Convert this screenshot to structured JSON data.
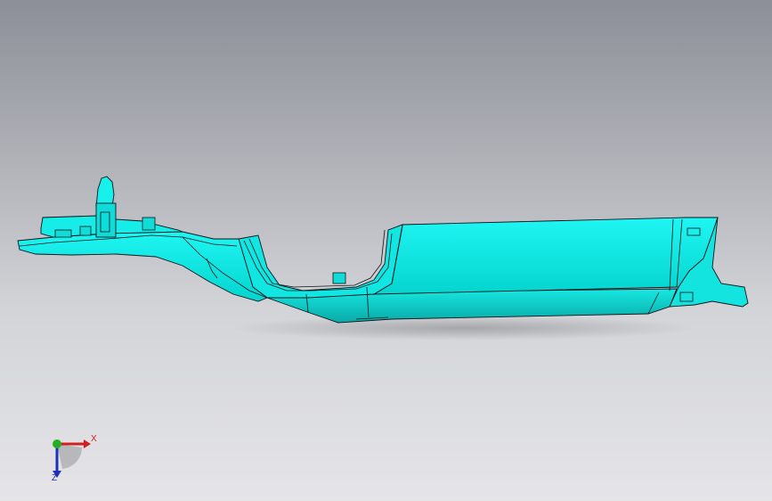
{
  "viewport": {
    "background_top": "#8c8f97",
    "background_bottom": "#e5e5e8",
    "part_color": "#00ffff",
    "edge_color": "#101418"
  },
  "triad": {
    "x_label": "X",
    "z_label": "Z",
    "x_color": "#d21f1f",
    "y_color": "#22b022",
    "z_color": "#1f2fb8"
  }
}
